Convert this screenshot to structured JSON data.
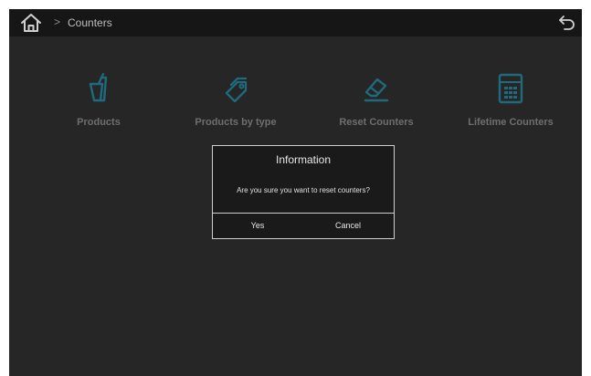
{
  "topbar": {
    "home_icon": "home-icon",
    "separator": ">",
    "breadcrumb": "Counters",
    "back_icon": "back-arrow-icon"
  },
  "tiles": [
    {
      "label": "Products",
      "icon": "cups-icon"
    },
    {
      "label": "Products by type",
      "icon": "tags-icon"
    },
    {
      "label": "Reset Counters",
      "icon": "eraser-icon"
    },
    {
      "label": "Lifetime Counters",
      "icon": "calculator-icon"
    }
  ],
  "dialog": {
    "title": "Information",
    "message": "Are you sure you want to reset counters?",
    "yes_label": "Yes",
    "cancel_label": "Cancel"
  },
  "colors": {
    "icon_teal": "#1f6a7c",
    "background": "#262626",
    "topbar": "#161616"
  }
}
